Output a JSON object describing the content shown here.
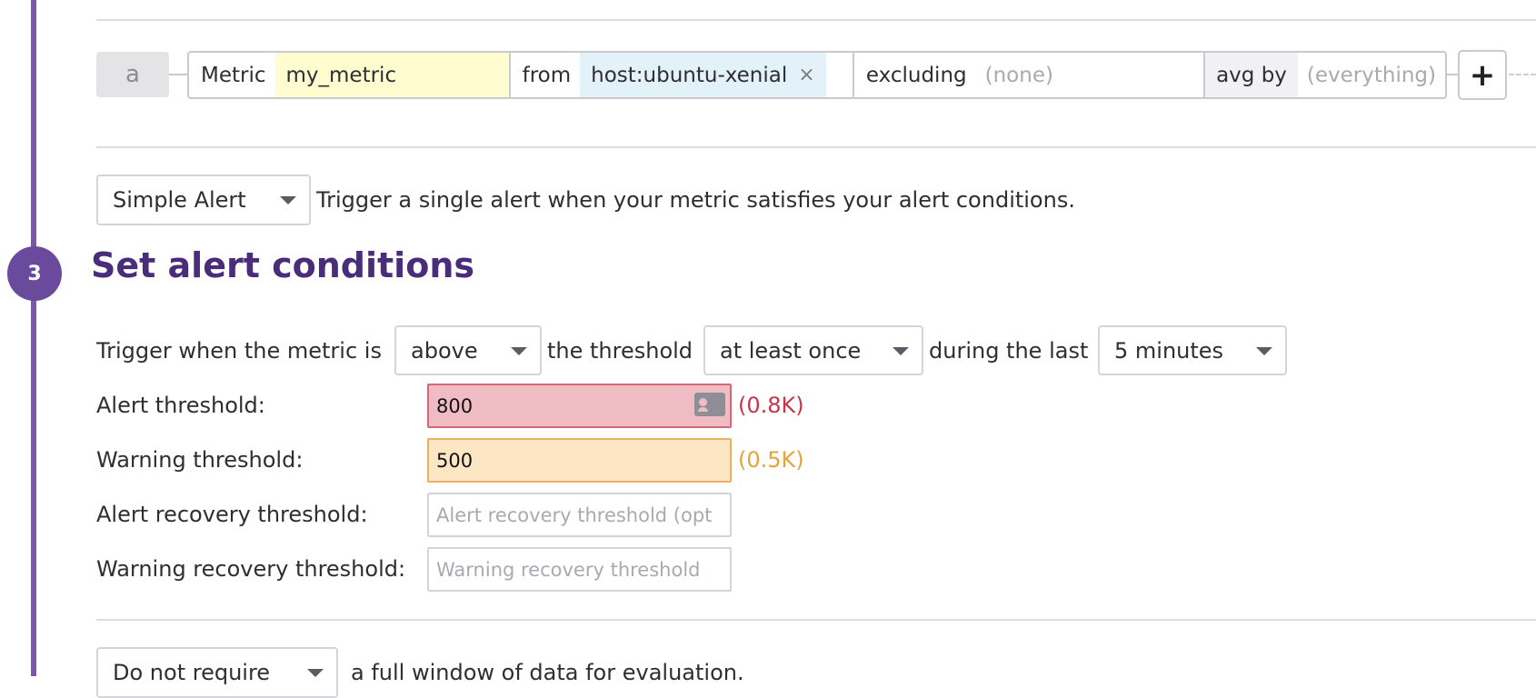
{
  "query": {
    "label": "a",
    "metric_keyword": "Metric",
    "metric_value": "my_metric",
    "from_keyword": "from",
    "from_tag": "host:ubuntu-xenial",
    "tag_remove_symbol": "×",
    "excluding_keyword": "excluding",
    "excluding_placeholder": "(none)",
    "avg_by_keyword": "avg by",
    "avg_by_placeholder": "(everything)",
    "add_symbol": "+"
  },
  "alert_type": {
    "selected": "Simple Alert",
    "description": "Trigger a single alert when your metric satisfies your alert conditions."
  },
  "section": {
    "step_number": "3",
    "title": "Set alert conditions"
  },
  "trigger": {
    "prefix": "Trigger when the metric is",
    "comparison": "above",
    "middle": "the threshold",
    "occurrence": "at least once",
    "suffix": "during the last",
    "window": "5 minutes"
  },
  "thresholds": {
    "alert_label": "Alert threshold:",
    "alert_value": "800",
    "alert_hint": "(0.8K)",
    "warning_label": "Warning threshold:",
    "warning_value": "500",
    "warning_hint": "(0.5K)",
    "alert_recovery_label": "Alert recovery threshold:",
    "alert_recovery_placeholder": "Alert recovery threshold (opt",
    "warning_recovery_label": "Warning recovery threshold:",
    "warning_recovery_placeholder": "Warning recovery threshold"
  },
  "data_window": {
    "selected": "Do not require",
    "description": "a full window of data for evaluation."
  },
  "colors": {
    "accent": "#6a4a9c",
    "alert": "#c7354b",
    "warning": "#e6a23c"
  }
}
